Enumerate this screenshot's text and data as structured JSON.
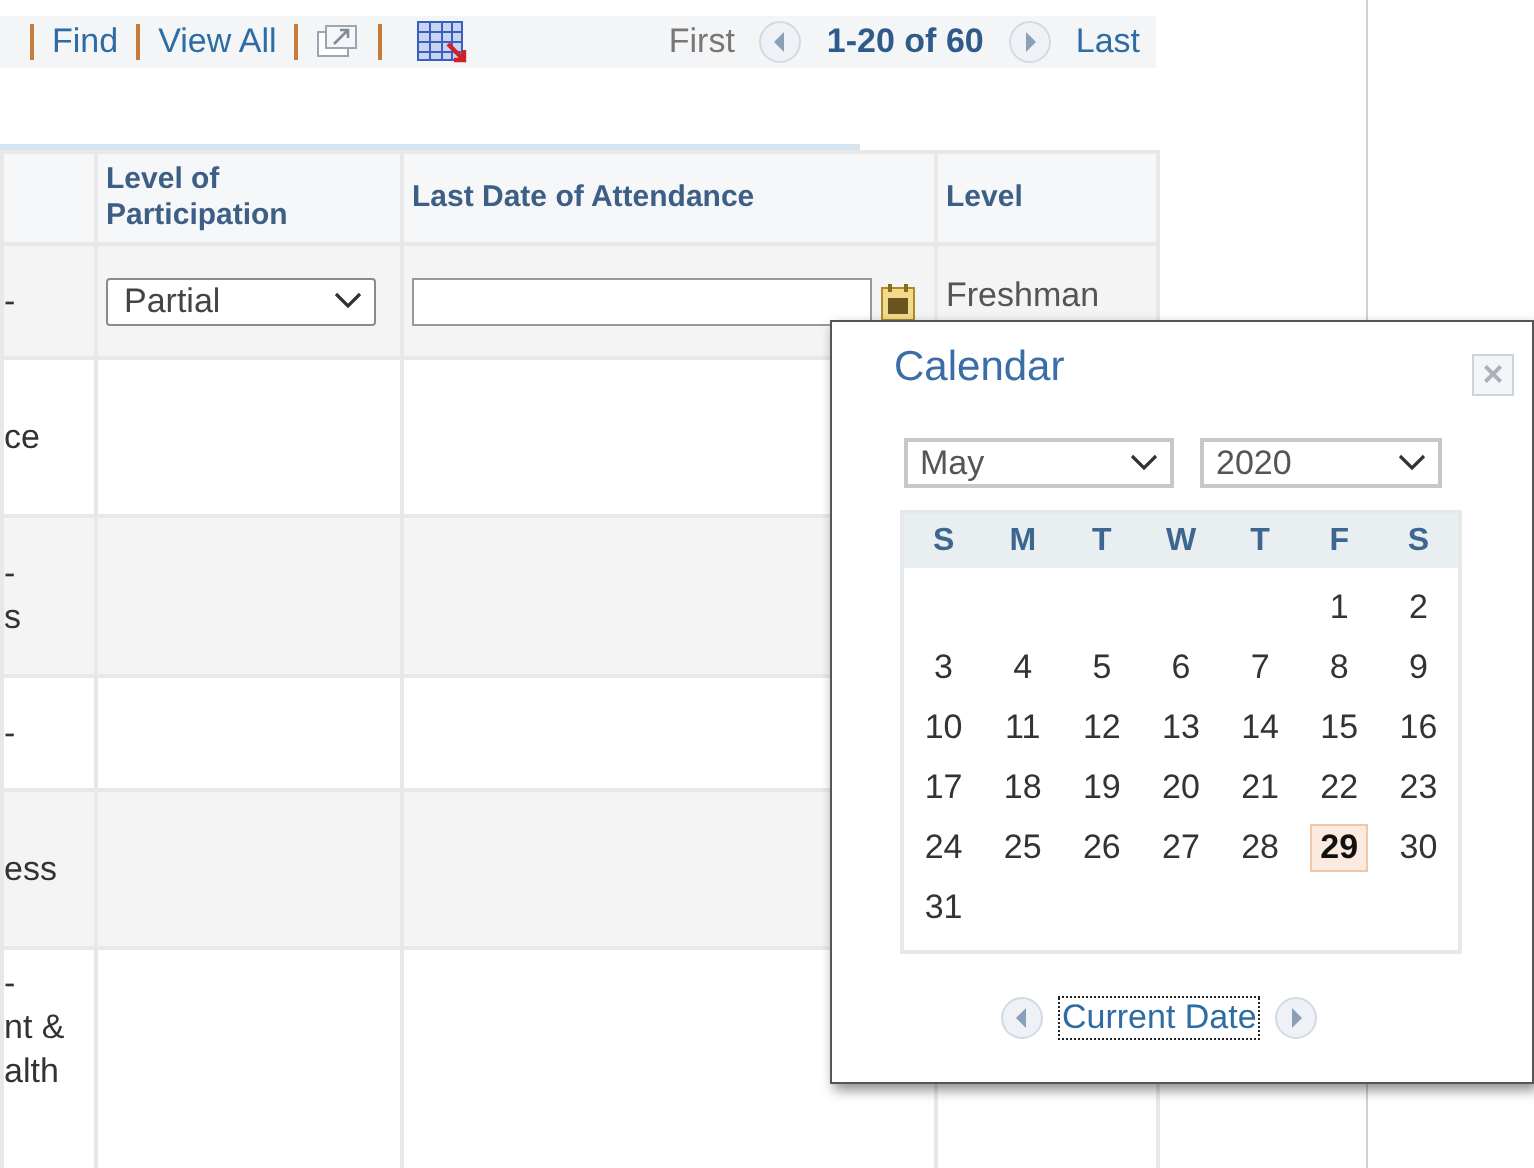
{
  "toolbar": {
    "links": [
      "Find",
      "View All"
    ],
    "first": "First",
    "range": "1-20 of 60",
    "last": "Last"
  },
  "table": {
    "columns": [
      "",
      "Level of Participation",
      "Last Date of Attendance",
      "Level"
    ],
    "rows": [
      {
        "column_1": [
          "-"
        ],
        "participation": "Partial",
        "last_date": "",
        "level": "Freshman"
      },
      {
        "column_1": [
          "ce"
        ]
      },
      {
        "column_1": [
          "-",
          "s"
        ]
      },
      {
        "column_1": [
          "-"
        ]
      },
      {
        "column_1": [
          "ess"
        ]
      },
      {
        "column_1": [
          "-",
          "nt &",
          "alth"
        ]
      }
    ]
  },
  "calendar": {
    "title": "Calendar",
    "close": "×",
    "month": "May",
    "year": "2020",
    "weekdays": [
      "S",
      "M",
      "T",
      "W",
      "T",
      "F",
      "S"
    ],
    "weeks": [
      {
        "right_aligned": true,
        "days": [
          {
            "label": "1",
            "selected": false
          },
          {
            "label": "2",
            "selected": false
          }
        ]
      },
      {
        "days": [
          {
            "label": "3",
            "selected": false
          },
          {
            "label": "4",
            "selected": false
          },
          {
            "label": "5",
            "selected": false
          },
          {
            "label": "6",
            "selected": false
          },
          {
            "label": "7",
            "selected": false
          },
          {
            "label": "8",
            "selected": false
          },
          {
            "label": "9",
            "selected": false
          }
        ]
      },
      {
        "days": [
          {
            "label": "10",
            "selected": false
          },
          {
            "label": "11",
            "selected": false
          },
          {
            "label": "12",
            "selected": false
          },
          {
            "label": "13",
            "selected": false
          },
          {
            "label": "14",
            "selected": false
          },
          {
            "label": "15",
            "selected": false
          },
          {
            "label": "16",
            "selected": false
          }
        ]
      },
      {
        "days": [
          {
            "label": "17",
            "selected": false
          },
          {
            "label": "18",
            "selected": false
          },
          {
            "label": "19",
            "selected": false
          },
          {
            "label": "20",
            "selected": false
          },
          {
            "label": "21",
            "selected": false
          },
          {
            "label": "22",
            "selected": false
          },
          {
            "label": "23",
            "selected": false
          }
        ]
      },
      {
        "days": [
          {
            "label": "24",
            "selected": false
          },
          {
            "label": "25",
            "selected": false
          },
          {
            "label": "26",
            "selected": false
          },
          {
            "label": "27",
            "selected": false
          },
          {
            "label": "28",
            "selected": false
          },
          {
            "label": "29",
            "selected": true
          },
          {
            "label": "30",
            "selected": false
          }
        ]
      },
      {
        "right_aligned": false,
        "days": [
          {
            "label": "31",
            "selected": false
          }
        ]
      }
    ],
    "current_date": "Current Date"
  }
}
